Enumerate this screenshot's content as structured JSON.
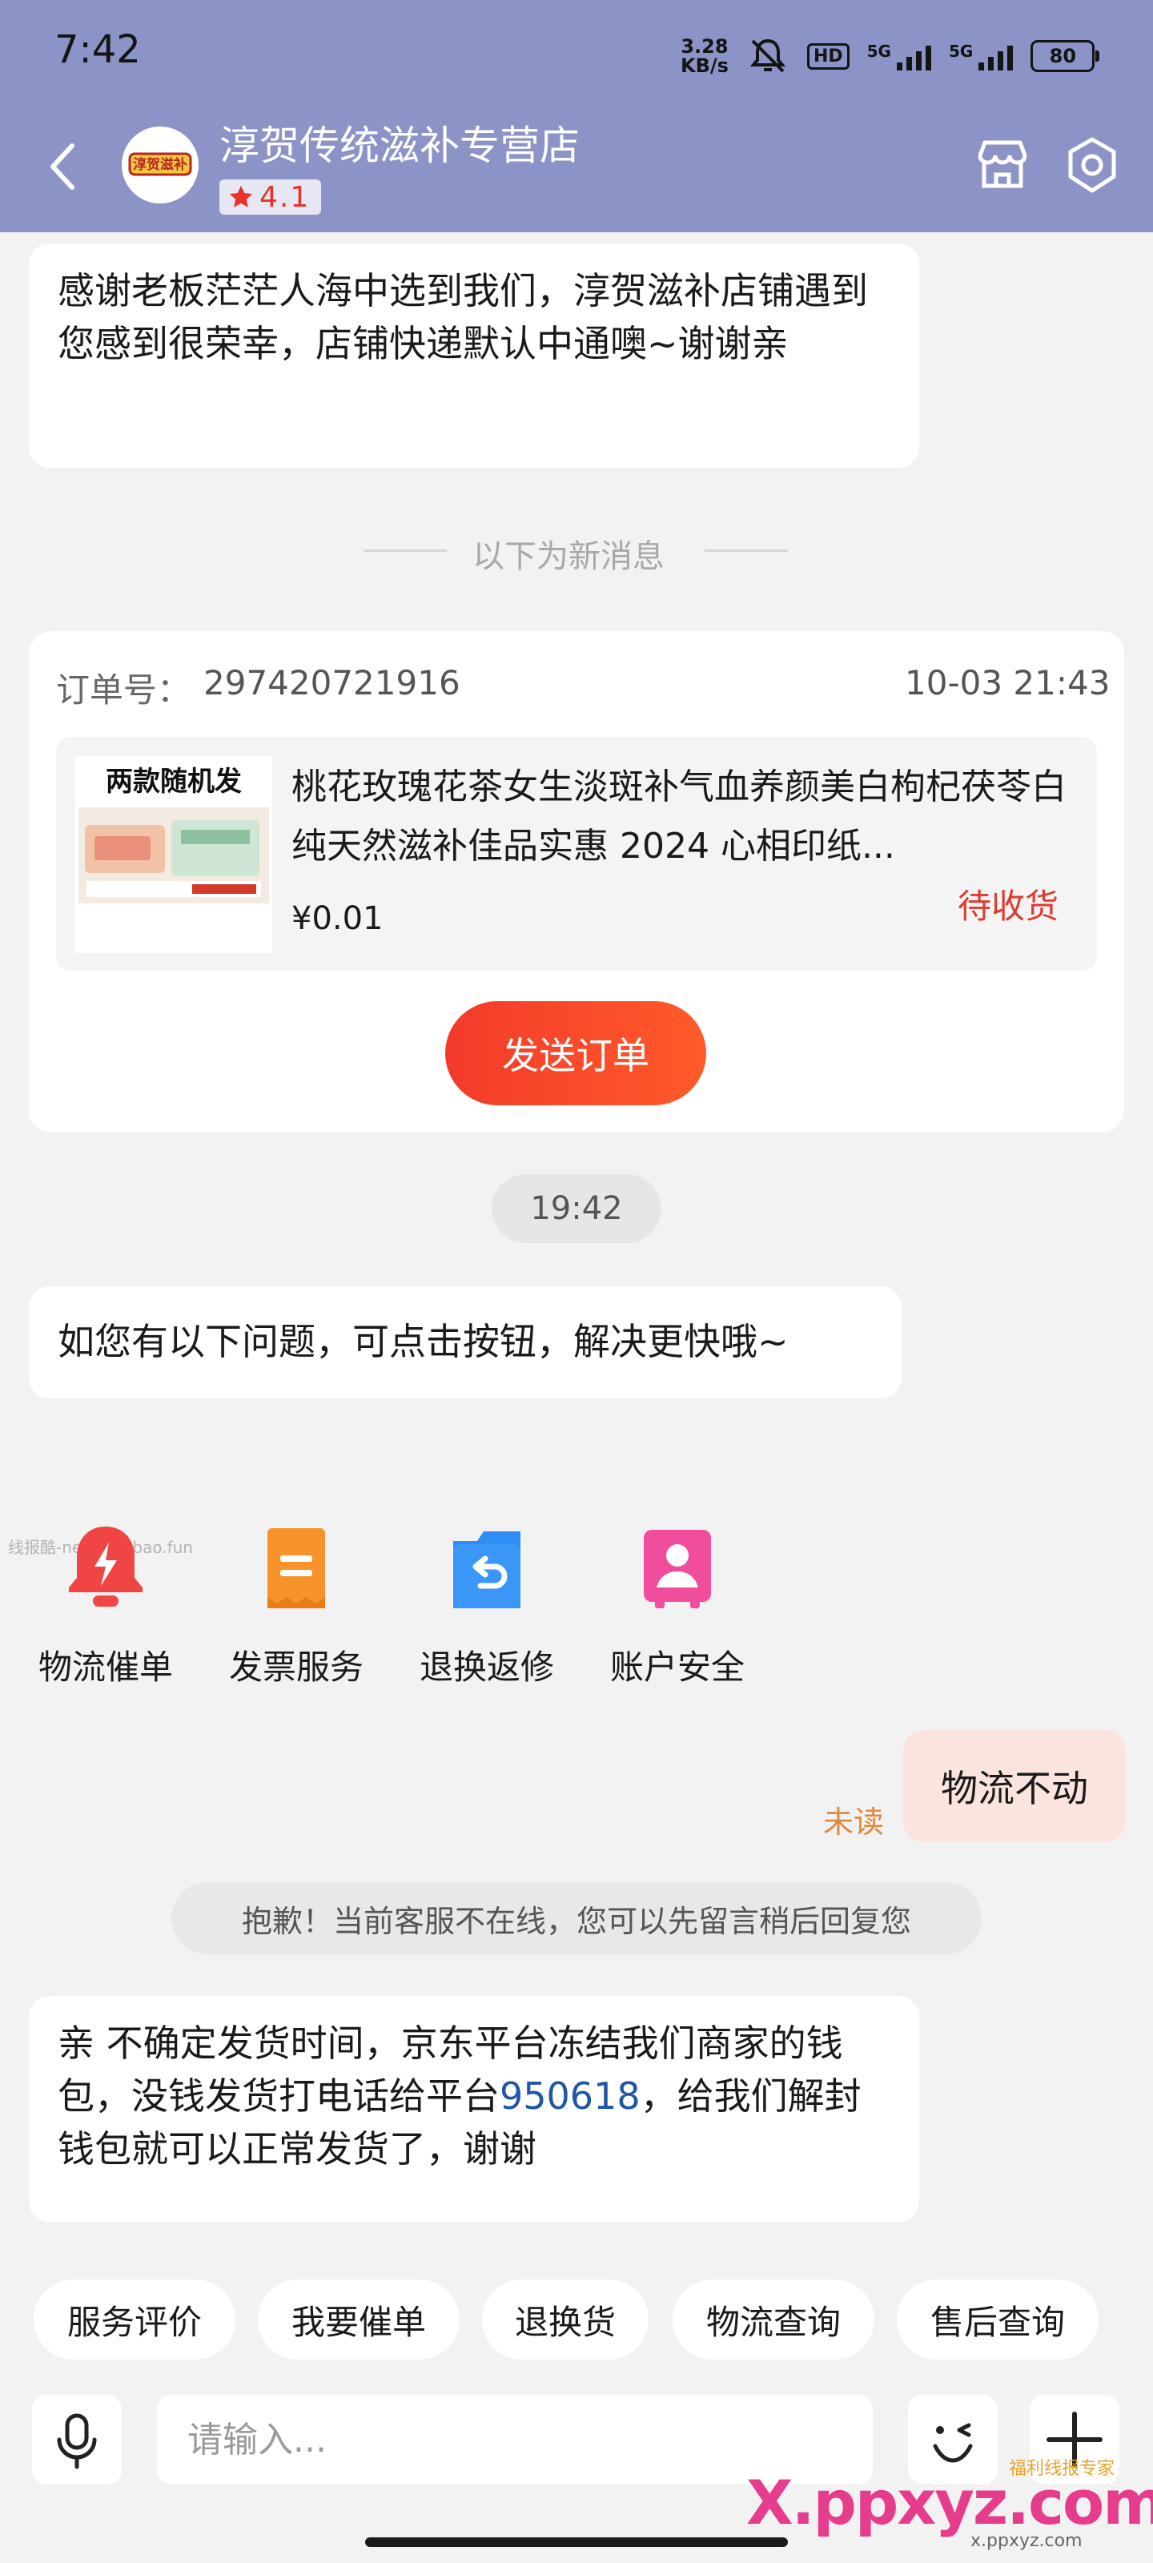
{
  "status_bar": {
    "time": "7:42",
    "net_speed_value": "3.28",
    "net_speed_unit": "KB/s",
    "network_1": "5G",
    "network_2": "5G",
    "hd_label": "HD",
    "battery": "80"
  },
  "header": {
    "shop_name": "淳贺传统滋补专营店",
    "rating": "4.1",
    "logo_text": "淳贺滋补"
  },
  "messages": {
    "thanks": "感谢老板茫茫人海中选到我们，淳贺滋补店铺遇到您感到很荣幸，店铺快递默认中通噢~谢谢亲",
    "divider": "以下为新消息",
    "time_chip": "19:42",
    "help": "如您有以下问题，可点击按钮，解决更快哦~",
    "user_message": "物流不动",
    "unread": "未读",
    "offline_notice": "抱歉！当前客服不在线，您可以先留言稍后回复您",
    "reply_part1": "亲  不确定发货时间，京东平台冻结我们商家的钱包，没钱发货打电话给平台",
    "reply_phone": "950618",
    "reply_part2": "，给我们解封钱包就可以正常发货了，谢谢"
  },
  "order_card": {
    "order_label": "订单号：",
    "order_number": "297420721916",
    "date": "10-03 21:43",
    "thumb_caption": "两款随机发",
    "product_title": "桃花玫瑰花茶女生淡斑补气血养颜美白枸杞茯苓白纯天然滋补佳品实惠  2024  心相印纸...",
    "price": "¥0.01",
    "status": "待收货",
    "send_button": "发送订单"
  },
  "quick_actions": [
    {
      "label": "物流催单",
      "icon": "logistics-urge-icon",
      "color": "#f04545"
    },
    {
      "label": "发票服务",
      "icon": "invoice-icon",
      "color": "#f7932a"
    },
    {
      "label": "退换返修",
      "icon": "return-icon",
      "color": "#2e8ef5"
    },
    {
      "label": "账户安全",
      "icon": "account-security-icon",
      "color": "#f04e9c"
    }
  ],
  "quick_chips": [
    "服务评价",
    "我要催单",
    "退换货",
    "物流查询",
    "售后查询"
  ],
  "input": {
    "placeholder": "请输入..."
  },
  "watermark": {
    "small": "线报酷-new.xianbao.fun",
    "main": "X.ppxyz.com",
    "top": "福利线报专家",
    "sub": "x.ppxyz.com"
  },
  "colors": {
    "header_bg": "#8c93c6",
    "accent_red": "#f33a2a",
    "page_bg": "#f2f2f2",
    "user_bubble": "#fbe4de"
  }
}
